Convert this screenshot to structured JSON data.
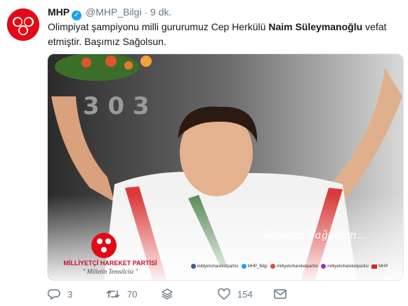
{
  "tweet": {
    "author_name": "MHP",
    "author_handle": "@MHP_Bilgi",
    "separator": "·",
    "timestamp": "9 dk.",
    "text_before": "Olimpiyat şampiyonu milli gururumuz Cep Herkülü ",
    "text_bold": "Naim Süleymanoğlu",
    "text_after": " vefat etmiştir. Başımız Sağolsun."
  },
  "media": {
    "handwritten_caption": "Başımız Sağolsun...",
    "party_name": "MİLLİYETÇİ HAREKET PARTİSİ",
    "party_slogan": "\" Milletin Temsilcisi \"",
    "social": [
      {
        "icon": "facebook-icon",
        "label": "milliyetcihareketpartisi",
        "color": "#3b5998"
      },
      {
        "icon": "twitter-icon",
        "label": "MHP_Bilgi",
        "color": "#1da1f2"
      },
      {
        "icon": "googleplus-icon",
        "label": "milliyetcihareketpartisi",
        "color": "#dd4b39"
      },
      {
        "icon": "instagram-icon",
        "label": "milliyetcihareketpartisi",
        "color": "#8a3ab9"
      },
      {
        "icon": "youtube-icon",
        "label": "MHP",
        "color": "#e62117"
      }
    ]
  },
  "actions": {
    "reply_count": "3",
    "retweet_count": "70",
    "like_count": "154"
  },
  "colors": {
    "brand_red": "#e30a17",
    "text_muted": "#657786",
    "verified_blue": "#1da1f2"
  }
}
